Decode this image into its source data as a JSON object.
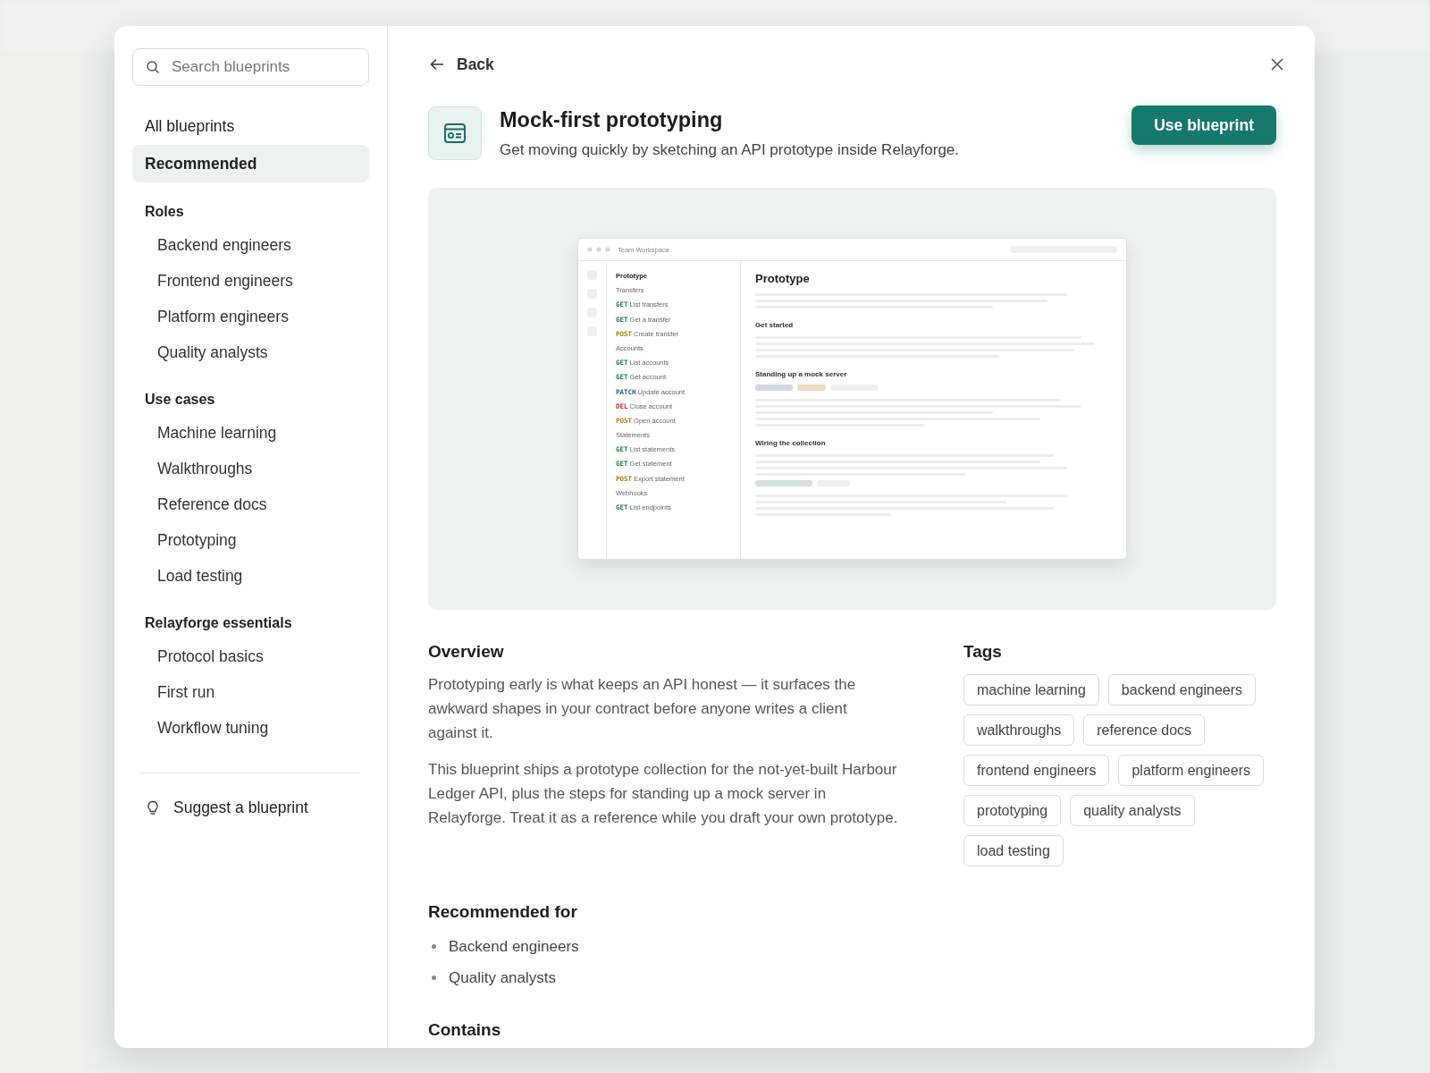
{
  "sidebar": {
    "search": {
      "placeholder": "Search blueprints"
    },
    "top_items": [
      {
        "label": "All blueprints",
        "selected": false
      },
      {
        "label": "Recommended",
        "selected": true
      }
    ],
    "sections": [
      {
        "heading": "Roles",
        "items": [
          "Backend engineers",
          "Frontend engineers",
          "Platform engineers",
          "Quality analysts"
        ]
      },
      {
        "heading": "Use cases",
        "items": [
          "Machine learning",
          "Walkthroughs",
          "Reference docs",
          "Prototyping",
          "Load testing"
        ]
      },
      {
        "heading": "Relayforge essentials",
        "items": [
          "Protocol basics",
          "First run",
          "Workflow tuning"
        ]
      }
    ],
    "suggest": "Suggest a blueprint"
  },
  "main": {
    "back": "Back",
    "title": "Mock-first prototyping",
    "subtitle": "Get moving quickly by sketching an API prototype inside Relayforge.",
    "action": "Use blueprint",
    "preview": {
      "window_title": "Team Workspace",
      "nav": [
        {
          "kind": "title",
          "label": "Prototype"
        },
        {
          "kind": "group",
          "label": "Transfers"
        },
        {
          "kind": "endpoint",
          "method": "GET",
          "color": "#2f7a4f",
          "label": "List transfers"
        },
        {
          "kind": "endpoint",
          "method": "GET",
          "color": "#2f7a4f",
          "label": "Get a transfer"
        },
        {
          "kind": "endpoint",
          "method": "POST",
          "color": "#b0800e",
          "label": "Create transfer"
        },
        {
          "kind": "group",
          "label": "Accounts"
        },
        {
          "kind": "endpoint",
          "method": "GET",
          "color": "#2f7a4f",
          "label": "List accounts"
        },
        {
          "kind": "endpoint",
          "method": "GET",
          "color": "#2f7a4f",
          "label": "Get account"
        },
        {
          "kind": "endpoint",
          "method": "PATCH",
          "color": "#2d5a9a",
          "label": "Update account"
        },
        {
          "kind": "endpoint",
          "method": "DEL",
          "color": "#a8323a",
          "label": "Close account"
        },
        {
          "kind": "endpoint",
          "method": "POST",
          "color": "#b0800e",
          "label": "Open account"
        },
        {
          "kind": "group",
          "label": "Statements"
        },
        {
          "kind": "endpoint",
          "method": "GET",
          "color": "#2f7a4f",
          "label": "List statements"
        },
        {
          "kind": "endpoint",
          "method": "GET",
          "color": "#2f7a4f",
          "label": "Get statement"
        },
        {
          "kind": "endpoint",
          "method": "POST",
          "color": "#b0800e",
          "label": "Export statement"
        },
        {
          "kind": "group",
          "label": "Webhooks"
        },
        {
          "kind": "endpoint",
          "method": "GET",
          "color": "#2f7a4f",
          "label": "List endpoints"
        }
      ],
      "doc_title": "Prototype",
      "doc_sections": [
        "Get started",
        "Standing up a mock server",
        "Wiring the collection"
      ]
    },
    "overview": {
      "heading": "Overview",
      "paragraphs": [
        "Prototyping early is what keeps an API honest — it surfaces the awkward shapes in your contract before anyone writes a client against it.",
        "This blueprint ships a prototype collection for the not-yet-built Harbour Ledger API, plus the steps for standing up a mock server in Relayforge. Treat it as a reference while you draft your own prototype."
      ]
    },
    "tags": {
      "heading": "Tags",
      "items": [
        "machine learning",
        "backend engineers",
        "walkthroughs",
        "reference docs",
        "frontend engineers",
        "platform engineers",
        "prototyping",
        "quality analysts",
        "load testing"
      ]
    },
    "recommended": {
      "heading": "Recommended for",
      "items": [
        "Backend engineers",
        "Quality analysts"
      ]
    },
    "contains": {
      "heading": "Contains"
    }
  }
}
